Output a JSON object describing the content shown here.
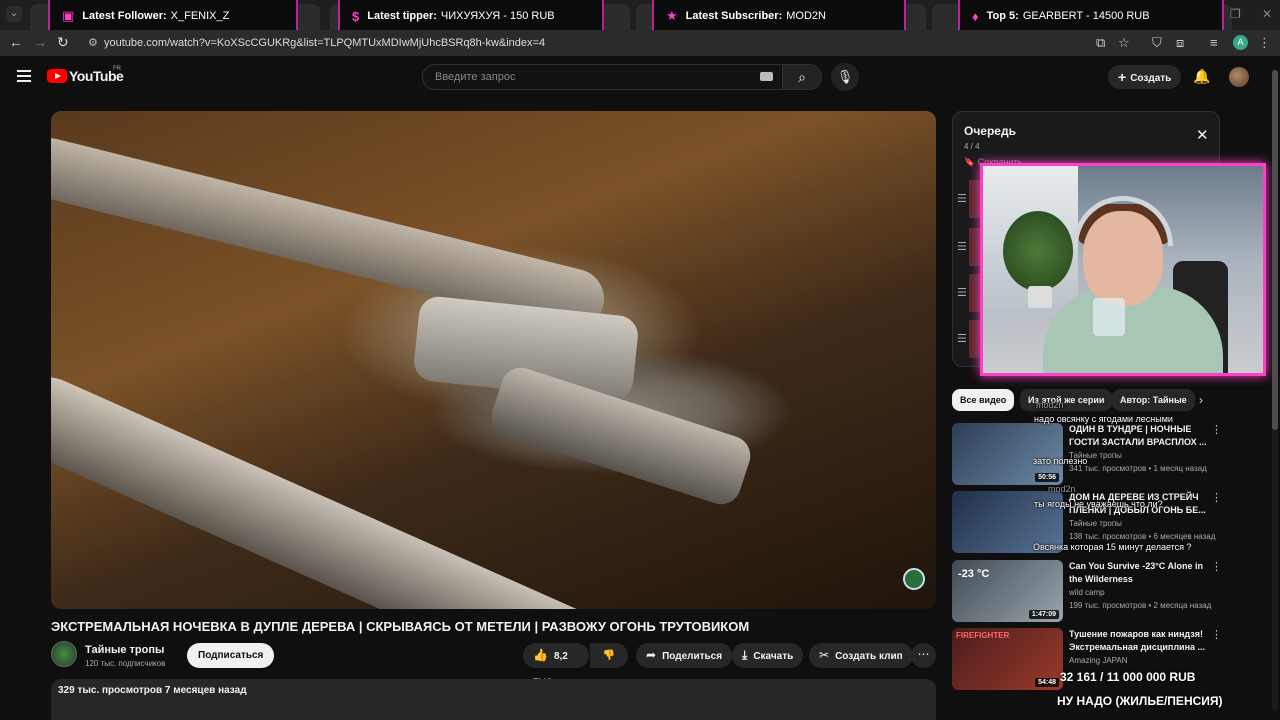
{
  "overlay": {
    "follower_label": "Latest Follower:",
    "follower_value": "X_FENIX_Z",
    "tipper_label": "Latest tipper:",
    "tipper_value": "ЧИХУЯХУЯ - 150 RUB",
    "subscriber_label": "Latest Subscriber:",
    "subscriber_value": "MOD2N",
    "top_label": "Top 5:",
    "top_value": "GEARBERT - 14500 RUB"
  },
  "browser": {
    "url": "youtube.com/watch?v=KoXScCGUKRg&list=TLPQMTUxMDIwMjUhcBSRq8h-kw&index=4",
    "profile_initial": "A"
  },
  "header": {
    "logo_text": "YouTube",
    "region": "FR",
    "search_placeholder": "Введите запрос",
    "create_label": "Создать"
  },
  "video": {
    "title": "ЭКСТРЕМАЛЬНАЯ НОЧЕВКА В ДУПЛЕ ДЕРЕВА | СКРЫВАЯСЬ ОТ МЕТЕЛИ | РАЗВОЖУ ОГОНЬ ТРУТОВИКОМ",
    "channel": "Тайные тропы",
    "subscribers": "120 тыс. подписчиков",
    "subscribe_label": "Подписаться",
    "likes": "8,2 тыс.",
    "share_label": "Поделиться",
    "download_label": "Скачать",
    "clip_label": "Создать клип",
    "views_date": "329 тыс. просмотров  7 месяцев назад"
  },
  "queue": {
    "title": "Очередь",
    "count": "4 / 4",
    "save_label": "Сохранить",
    "clear_label": "Удалить все"
  },
  "chips": [
    "Все видео",
    "Из этой же серии",
    "Автор: Тайные"
  ],
  "recommendations": [
    {
      "title": "ОДИН В ТУНДРЕ | НОЧНЫЕ ГОСТИ ЗАСТАЛИ ВРАСПЛОХ ...",
      "channel": "Тайные тропы",
      "meta": "341 тыс. просмотров • 1 месяц назад",
      "duration": "50:56",
      "colors": [
        "#2c3e55",
        "#6d8aa6"
      ]
    },
    {
      "title": "ДОМ НА ДЕРЕВЕ ИЗ СТРЕЙЧ ПЛЕНКИ | ДОБЫЛ ОГОНЬ БЕ...",
      "channel": "Тайные тропы",
      "meta": "138 тыс. просмотров • 6 месяцев назад",
      "duration": "",
      "colors": [
        "#1f3048",
        "#587394"
      ]
    },
    {
      "title": "Can You Survive -23°C Alone in the Wilderness",
      "channel": "wild camp",
      "meta": "199 тыс. просмотров • 2 месяца назад",
      "duration": "1:47:09",
      "thumb_text": "-23 °C",
      "colors": [
        "#3f4a52",
        "#9aa5ad"
      ]
    },
    {
      "title": "Тушение пожаров как ниндзя! Экстремальная дисциплина ...",
      "channel": "Amazing JAPAN",
      "meta": "",
      "duration": "54:48",
      "thumb_text": "FIREFIGHTER",
      "colors": [
        "#4a1d1d",
        "#9c3a2a"
      ]
    }
  ],
  "chat": [
    {
      "user": "mod2n",
      "text": "надо овсянку с ягодами лесными"
    },
    {
      "user": "",
      "text": "зато полезно"
    },
    {
      "user": "mod2n",
      "text": "ты ягоды не уважаешь что ли?"
    },
    {
      "user": "",
      "text": "Овсянка которая 15 минут делается ?"
    }
  ],
  "donation": {
    "amount": "32 161 / 11 000 000 RUB",
    "goal": "НУ НАДО (ЖИЛЬЕ/ПЕНСИЯ)"
  },
  "colors": {
    "accent": "#ff3fc8",
    "youtube_red": "#ff0000",
    "background": "#0f0f0f"
  }
}
